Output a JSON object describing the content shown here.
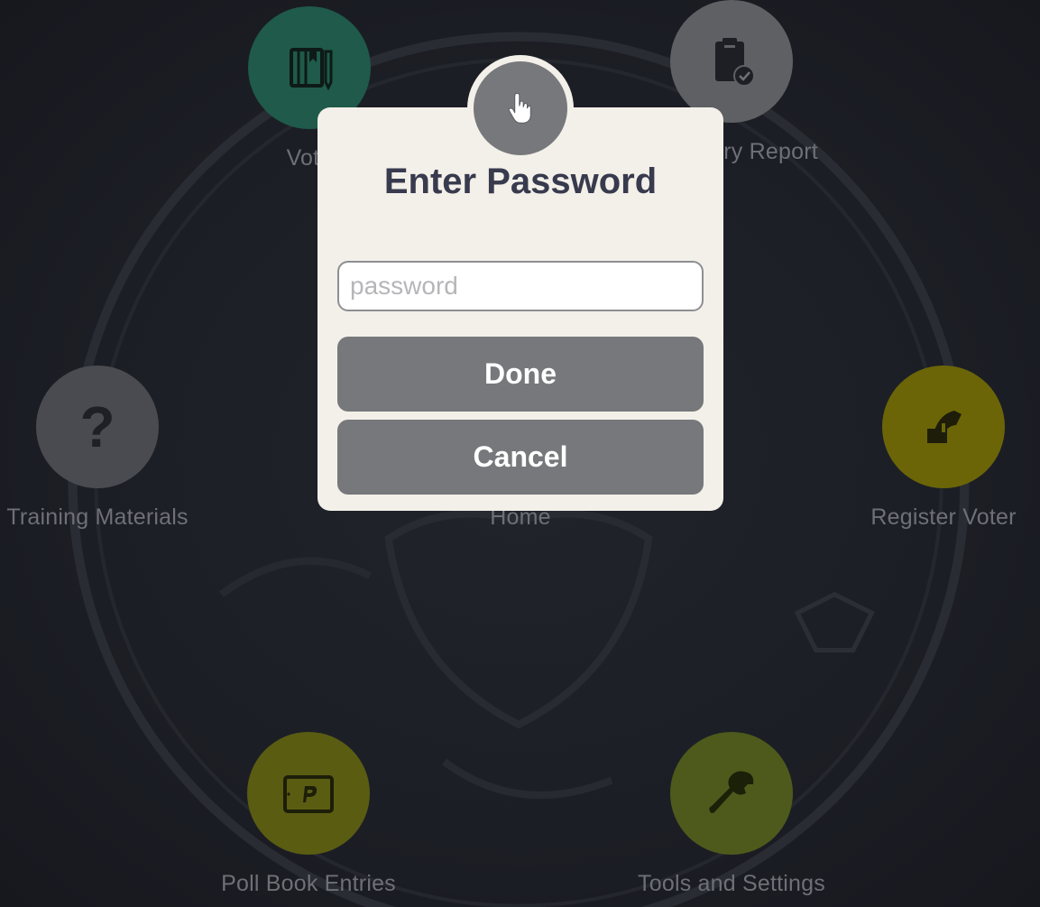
{
  "menu": {
    "vote": {
      "label": "Vote",
      "color": "#1f5a4a",
      "icon": "book-pen-icon"
    },
    "summary_report": {
      "label": "Summary Report",
      "color": "#5f6064",
      "icon": "clipboard-check-icon"
    },
    "training": {
      "label": "Training Materials",
      "color": "#4a4b50",
      "icon": "question-mark-icon",
      "glyph": "?"
    },
    "home": {
      "label": "Home"
    },
    "register": {
      "label": "Register Voter",
      "color": "#6b6508",
      "icon": "hand-ballot-icon"
    },
    "poll_book": {
      "label": "Poll Book Entries",
      "color": "#5a5c12",
      "icon": "tablet-p-icon"
    },
    "tools": {
      "label": "Tools and Settings",
      "color": "#4d5a1c",
      "icon": "wrench-icon"
    }
  },
  "dialog": {
    "icon": "hand-pointer-icon",
    "title": "Enter Password",
    "password_value": "",
    "password_placeholder": "password",
    "done_label": "Done",
    "cancel_label": "Cancel"
  }
}
